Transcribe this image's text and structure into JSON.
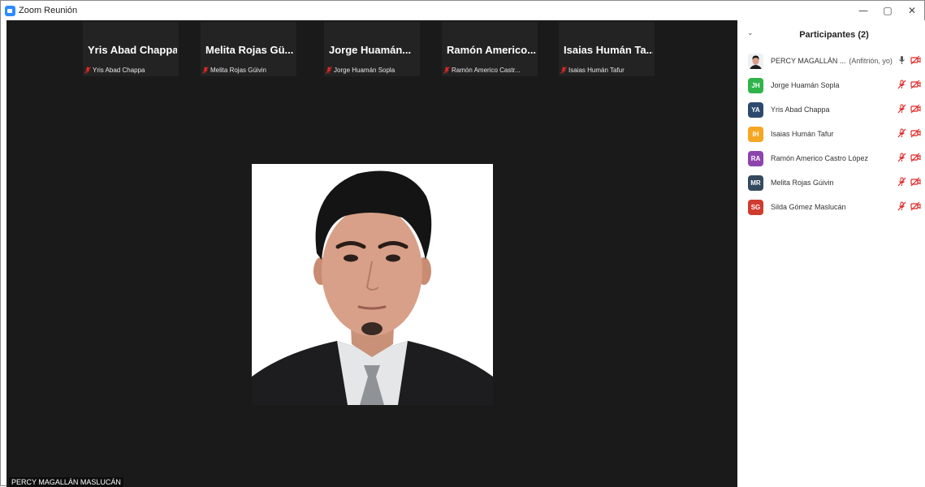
{
  "window": {
    "title": "Zoom Reunión",
    "controls": {
      "minimize": "—",
      "restore": "▢",
      "close": "✕"
    }
  },
  "thumbnails": [
    {
      "name": "Yris Abad Chappa",
      "label": "Yris Abad Chappa"
    },
    {
      "name": "Melita Rojas Gü...",
      "label": "Melita Rojas Gúivin"
    },
    {
      "name": "Jorge Huamán...",
      "label": "Jorge Huamán Sopla"
    },
    {
      "name": "Ramón Americo...",
      "label": "Ramón Americo Castr..."
    },
    {
      "name": "Isaias Humán Ta...",
      "label": "Isaias Humán Tafur"
    }
  ],
  "self_view": {
    "label": "PERCY MAGALLÁN MASLUCÁN"
  },
  "panel": {
    "title": "Participantes (2)",
    "host": {
      "name": "PERCY MAGALLÁN ...",
      "role": "(Anfitrión, yo)"
    },
    "participants": [
      {
        "initials": "JH",
        "name": "Jorge Huamán Sopla",
        "color": "#2fb44a"
      },
      {
        "initials": "YA",
        "name": "Yris Abad Chappa",
        "color": "#2c4a6e"
      },
      {
        "initials": "IH",
        "name": "Isaias Humán Tafur",
        "color": "#f5a623"
      },
      {
        "initials": "RA",
        "name": "Ramón Americo Castro López",
        "color": "#8e44ad"
      },
      {
        "initials": "MR",
        "name": "Melita Rojas Gúivin",
        "color": "#34495e"
      },
      {
        "initials": "SG",
        "name": "Silda Gómez Maslucán",
        "color": "#d13b2f"
      }
    ]
  },
  "colors": {
    "meeting_bg": "#1a1a1a",
    "thumb_bg": "#232323",
    "muted_red": "#e02828",
    "accent": "#2d8cff"
  }
}
